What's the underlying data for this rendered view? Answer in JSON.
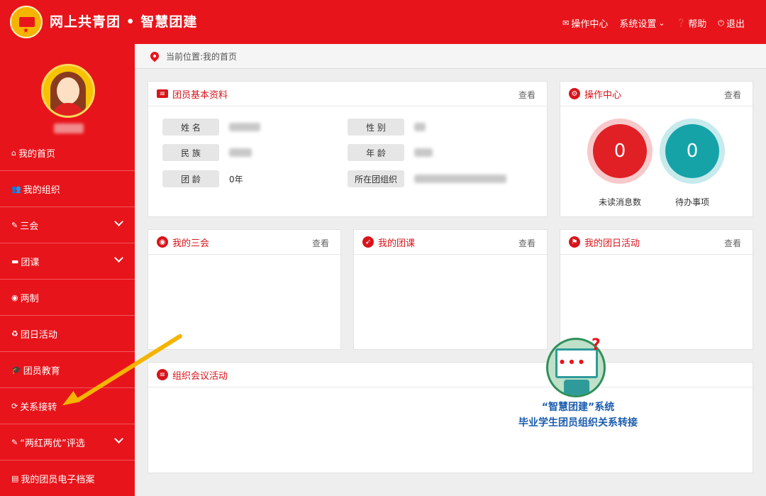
{
  "header": {
    "title": "网上共青团 • 智慧团建",
    "nav": [
      {
        "icon": "envelope-icon",
        "label": "操作中心"
      },
      {
        "icon": "chevron-down-icon",
        "label": "系统设置"
      },
      {
        "icon": "help-icon",
        "label": "帮助"
      },
      {
        "icon": "power-icon",
        "label": "退出"
      }
    ]
  },
  "sidebar": {
    "items": [
      {
        "icon": "home-icon",
        "label": "我的首页",
        "expandable": false
      },
      {
        "icon": "users-icon",
        "label": "我的组织",
        "expandable": false
      },
      {
        "icon": "edit-icon",
        "label": "三会",
        "expandable": true
      },
      {
        "icon": "folder-icon",
        "label": "团课",
        "expandable": true
      },
      {
        "icon": "circle-dot-icon",
        "label": "两制",
        "expandable": false
      },
      {
        "icon": "recycle-icon",
        "label": "团日活动",
        "expandable": false
      },
      {
        "icon": "graduation-cap-icon",
        "label": "团员教育",
        "expandable": false
      },
      {
        "icon": "refresh-icon",
        "label": "关系接转",
        "expandable": false
      },
      {
        "icon": "edit-icon",
        "label": "“两红两优”评选",
        "expandable": true
      },
      {
        "icon": "file-icon",
        "label": "我的团员电子档案",
        "expandable": false
      }
    ]
  },
  "breadcrumb": {
    "text": "当前位置:我的首页"
  },
  "basic_info": {
    "title": "团员基本资料",
    "view": "查看",
    "labels": {
      "name": "姓 名",
      "gender": "性 别",
      "ethnicity": "民 族",
      "age": "年 龄",
      "league_age": "团 龄",
      "org": "所在团组织"
    },
    "league_age_value": "0年"
  },
  "ops_center": {
    "title": "操作中心",
    "view": "查看",
    "unread_count": "0",
    "unread_label": "未读消息数",
    "todo_count": "0",
    "todo_label": "待办事项",
    "colors": {
      "unread": "#e02025",
      "todo": "#15a3a8"
    }
  },
  "panels": {
    "meetings": {
      "title": "我的三会",
      "view": "查看"
    },
    "lessons": {
      "title": "我的团课",
      "view": "查看"
    },
    "activities": {
      "title": "我的团日活动",
      "view": "查看"
    },
    "org_meetings": {
      "title": "组织会议活动"
    }
  },
  "promo": {
    "line1": "“智慧团建”系统",
    "line2": "毕业学生团员组织关系转接"
  },
  "colors": {
    "brand": "#e8141b",
    "promo_text": "#1a5cae",
    "arrow": "#f5b400"
  }
}
